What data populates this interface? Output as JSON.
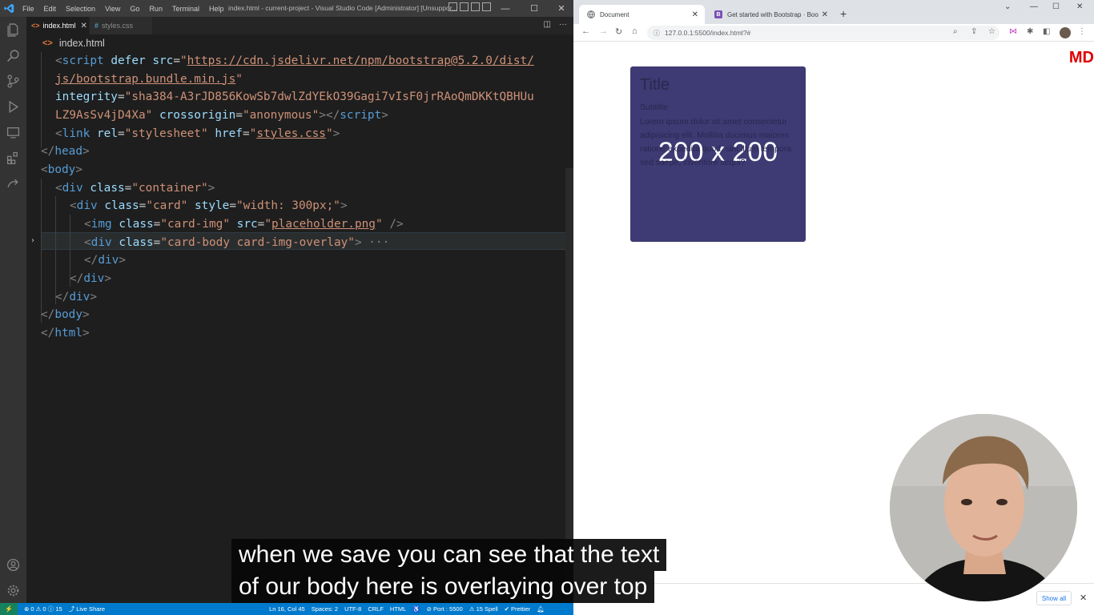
{
  "vscode": {
    "menu": [
      "File",
      "Edit",
      "Selection",
      "View",
      "Go",
      "Run",
      "Terminal",
      "Help"
    ],
    "window_title": "index.html - current-project - Visual Studio Code [Administrator] [Unsuppor...",
    "tabs": [
      {
        "label": "index.html",
        "icon": "<>",
        "active": true
      },
      {
        "label": "styles.css",
        "icon": "#",
        "active": false
      }
    ],
    "breadcrumb": "index.html",
    "code_lines": [
      {
        "indent": 1,
        "parts": [
          [
            "t",
            "<"
          ],
          [
            "tg",
            "script"
          ],
          [
            "x",
            " "
          ],
          [
            "at",
            "defer"
          ],
          [
            "x",
            " "
          ],
          [
            "at",
            "src"
          ],
          [
            "x",
            "="
          ],
          [
            "st",
            "\""
          ],
          [
            "stu",
            "https://cdn.jsdelivr.net/npm/bootstrap@5.2.0/dist/"
          ]
        ]
      },
      {
        "indent": 1,
        "parts": [
          [
            "stu",
            "js/bootstrap.bundle.min.js"
          ],
          [
            "st",
            "\""
          ]
        ]
      },
      {
        "indent": 1,
        "parts": [
          [
            "at",
            "integrity"
          ],
          [
            "x",
            "="
          ],
          [
            "st",
            "\"sha384-A3rJD856KowSb7dwlZdYEkO39Gagi7vIsF0jrRAoQmDKKtQBHUu"
          ]
        ]
      },
      {
        "indent": 1,
        "parts": [
          [
            "st",
            "LZ9AsSv4jD4Xa\""
          ],
          [
            "x",
            " "
          ],
          [
            "at",
            "crossorigin"
          ],
          [
            "x",
            "="
          ],
          [
            "st",
            "\"anonymous\""
          ],
          [
            "t",
            ">"
          ],
          [
            "t",
            "</"
          ],
          [
            "tg",
            "script"
          ],
          [
            "t",
            ">"
          ]
        ]
      },
      {
        "indent": 1,
        "parts": [
          [
            "t",
            "<"
          ],
          [
            "tg",
            "link"
          ],
          [
            "x",
            " "
          ],
          [
            "at",
            "rel"
          ],
          [
            "x",
            "="
          ],
          [
            "st",
            "\"stylesheet\""
          ],
          [
            "x",
            " "
          ],
          [
            "at",
            "href"
          ],
          [
            "x",
            "="
          ],
          [
            "st",
            "\""
          ],
          [
            "stu",
            "styles.css"
          ],
          [
            "st",
            "\""
          ],
          [
            "t",
            ">"
          ]
        ]
      },
      {
        "indent": 0,
        "parts": [
          [
            "t",
            "</"
          ],
          [
            "tg",
            "head"
          ],
          [
            "t",
            ">"
          ]
        ]
      },
      {
        "indent": 0,
        "parts": [
          [
            "t",
            "<"
          ],
          [
            "tg",
            "body"
          ],
          [
            "t",
            ">"
          ]
        ]
      },
      {
        "indent": 1,
        "parts": [
          [
            "t",
            "<"
          ],
          [
            "tg",
            "div"
          ],
          [
            "x",
            " "
          ],
          [
            "at",
            "class"
          ],
          [
            "x",
            "="
          ],
          [
            "st",
            "\"container\""
          ],
          [
            "t",
            ">"
          ]
        ]
      },
      {
        "indent": 2,
        "parts": [
          [
            "t",
            "<"
          ],
          [
            "tg",
            "div"
          ],
          [
            "x",
            " "
          ],
          [
            "at",
            "class"
          ],
          [
            "x",
            "="
          ],
          [
            "st",
            "\"card\""
          ],
          [
            "x",
            " "
          ],
          [
            "at",
            "style"
          ],
          [
            "x",
            "="
          ],
          [
            "st",
            "\"width: 300px;\""
          ],
          [
            "t",
            ">"
          ]
        ]
      },
      {
        "indent": 3,
        "parts": [
          [
            "t",
            "<"
          ],
          [
            "tg",
            "img"
          ],
          [
            "x",
            " "
          ],
          [
            "at",
            "class"
          ],
          [
            "x",
            "="
          ],
          [
            "st",
            "\"card-img\""
          ],
          [
            "x",
            " "
          ],
          [
            "at",
            "src"
          ],
          [
            "x",
            "="
          ],
          [
            "st",
            "\""
          ],
          [
            "stu",
            "placeholder.png"
          ],
          [
            "st",
            "\""
          ],
          [
            "x",
            " "
          ],
          [
            "t",
            "/>"
          ]
        ]
      },
      {
        "indent": 3,
        "parts": [
          [
            "t",
            "<"
          ],
          [
            "tg",
            "div"
          ],
          [
            "x",
            " "
          ],
          [
            "at",
            "class"
          ],
          [
            "x",
            "="
          ],
          [
            "st",
            "\"card-body card-img-overlay\""
          ],
          [
            "t",
            ">"
          ],
          [
            "t",
            " ···"
          ]
        ]
      },
      {
        "indent": 3,
        "parts": [
          [
            "t",
            "</"
          ],
          [
            "tg",
            "div"
          ],
          [
            "t",
            ">"
          ]
        ]
      },
      {
        "indent": 2,
        "parts": [
          [
            "t",
            "</"
          ],
          [
            "tg",
            "div"
          ],
          [
            "t",
            ">"
          ]
        ]
      },
      {
        "indent": 1,
        "parts": [
          [
            "t",
            "</"
          ],
          [
            "tg",
            "div"
          ],
          [
            "t",
            ">"
          ]
        ]
      },
      {
        "indent": 0,
        "parts": [
          [
            "t",
            "</"
          ],
          [
            "tg",
            "body"
          ],
          [
            "t",
            ">"
          ]
        ]
      },
      {
        "indent": 0,
        "parts": [
          [
            "t",
            "</"
          ],
          [
            "tg",
            "html"
          ],
          [
            "t",
            ">"
          ]
        ]
      }
    ],
    "status": {
      "problems": "⊗ 0 ⚠ 0 ⓘ 15",
      "live_share": "Live Share",
      "position": "Ln 16, Col 45",
      "spaces": "Spaces: 2",
      "encoding": "UTF-8",
      "eol": "CRLF",
      "language": "HTML",
      "port": "Port : 5500",
      "spell": "15 Spell",
      "prettier": "Prettier"
    }
  },
  "browser": {
    "tabs": [
      {
        "label": "Document",
        "active": true
      },
      {
        "label": "Get started with Bootstrap · Boo",
        "active": false
      }
    ],
    "url": "127.0.0.1:5500/index.html?#",
    "logo_text": "MD",
    "card": {
      "title": "Title",
      "subtitle": "Subtitle",
      "text": "Lorem ipsum dolor sit amet consectetur adipisicing elit. Mollitia ducimus maiores ratione expedita quod, sint illum tempora sed saepe, inventore sequi?",
      "placeholder_label": "200 x 200"
    },
    "download_bar": {
      "show_all": "Show all"
    }
  },
  "captions": [
    "when we save you can see that the text",
    "of our body here is overlaying over top"
  ],
  "colors": {
    "vscode_bg": "#1e1e1e",
    "statusbar": "#007acc",
    "card_bg": "#3e3a73",
    "logo_red": "#e00000"
  }
}
